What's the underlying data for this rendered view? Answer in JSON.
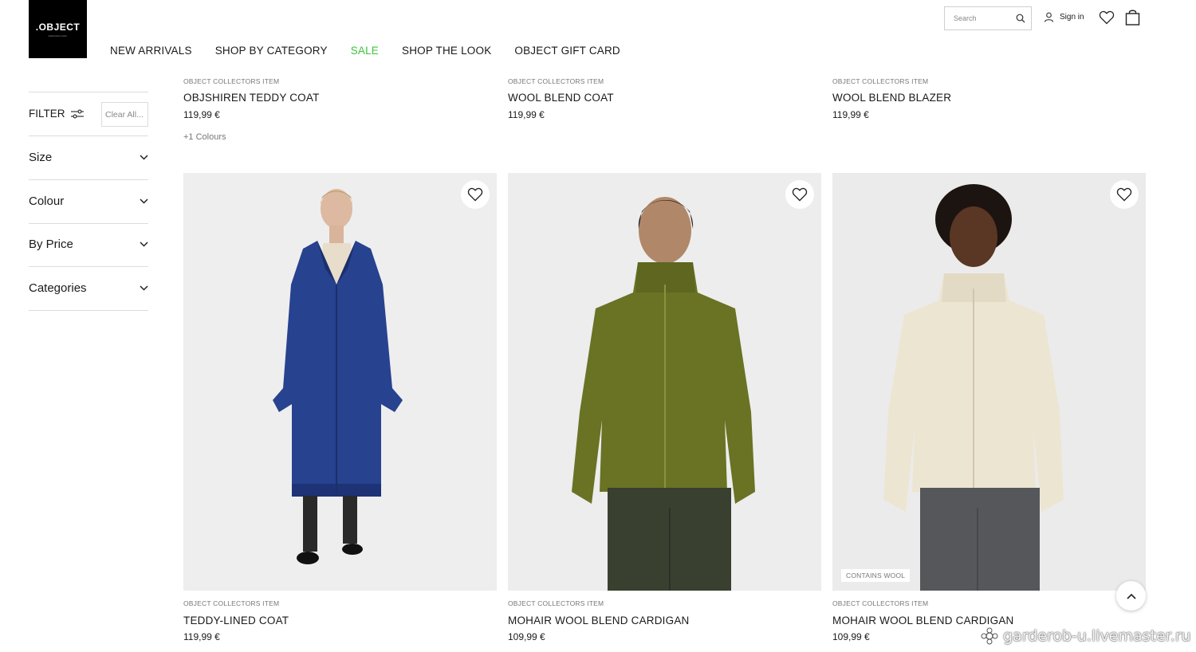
{
  "header": {
    "logo_text": ".OBJECT",
    "logo_sub": "collectors item",
    "nav": [
      "NEW ARRIVALS",
      "SHOP BY CATEGORY",
      "SALE",
      "SHOP THE LOOK",
      "OBJECT GIFT CARD"
    ],
    "search_placeholder": "Search",
    "sign_in": "Sign in",
    "accent_sale_color": "#3cc43c"
  },
  "sidebar": {
    "filter_label": "FILTER",
    "clear_all": "Clear All...",
    "facets": [
      "Size",
      "Colour",
      "By Price",
      "Categories"
    ]
  },
  "products_top": [
    {
      "brand": "OBJECT COLLECTORS ITEM",
      "name": "OBJSHIREN TEDDY COAT",
      "price": "119,99 €",
      "colours": "+1 Colours"
    },
    {
      "brand": "OBJECT COLLECTORS ITEM",
      "name": "WOOL BLEND COAT",
      "price": "119,99 €"
    },
    {
      "brand": "OBJECT COLLECTORS ITEM",
      "name": "WOOL BLEND BLAZER",
      "price": "119,99 €"
    }
  ],
  "products_bottom": [
    {
      "brand": "OBJECT COLLECTORS ITEM",
      "name": "TEDDY-LINED COAT",
      "price": "119,99 €"
    },
    {
      "brand": "OBJECT COLLECTORS ITEM",
      "name": "MOHAIR WOOL BLEND CARDIGAN",
      "price": "109,99 €"
    },
    {
      "brand": "OBJECT COLLECTORS ITEM",
      "name": "MOHAIR WOOL BLEND CARDIGAN",
      "price": "109,99 €",
      "tag": "CONTAINS WOOL"
    }
  ],
  "watermark": "garderob-u.livemaster.ru"
}
